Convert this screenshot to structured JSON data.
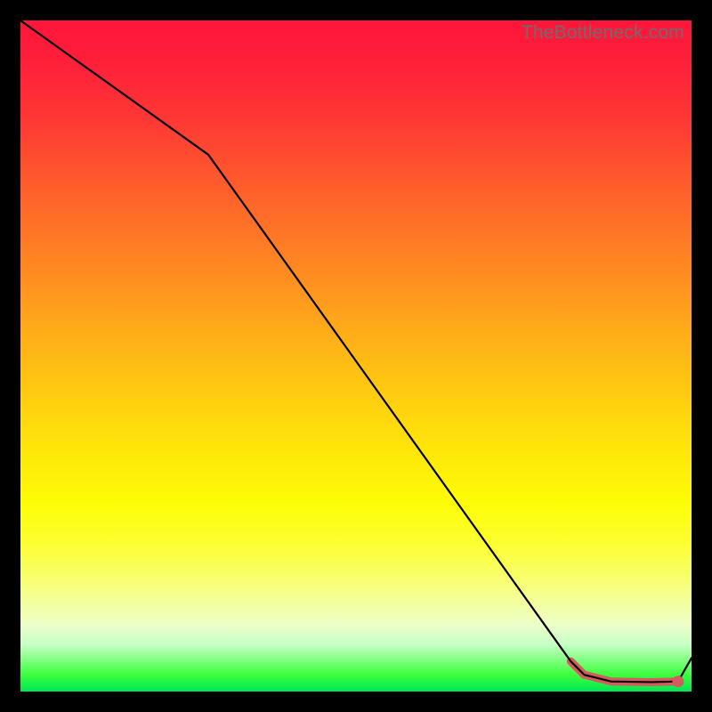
{
  "watermark": "TheBottleneck.com",
  "chart_data": {
    "type": "line",
    "title": "",
    "xlabel": "",
    "ylabel": "",
    "xlim": [
      0,
      100
    ],
    "ylim": [
      0,
      100
    ],
    "series": [
      {
        "name": "bottleneck-curve",
        "x": [
          0,
          28,
          82,
          84,
          88,
          94,
          98,
          100
        ],
        "values": [
          100,
          80,
          4.5,
          2.5,
          1.5,
          1.4,
          1.5,
          5
        ]
      }
    ],
    "highlight": {
      "name": "optimal-range",
      "x": [
        82,
        84,
        88,
        94,
        98
      ],
      "values": [
        4.5,
        2.5,
        1.5,
        1.4,
        1.5
      ]
    },
    "marker": {
      "x": 98,
      "value": 1.5
    },
    "colors": {
      "line": "#000000",
      "highlight": "#d65a5f",
      "gradient_top": "#ff153a",
      "gradient_bottom": "#00e756"
    }
  }
}
